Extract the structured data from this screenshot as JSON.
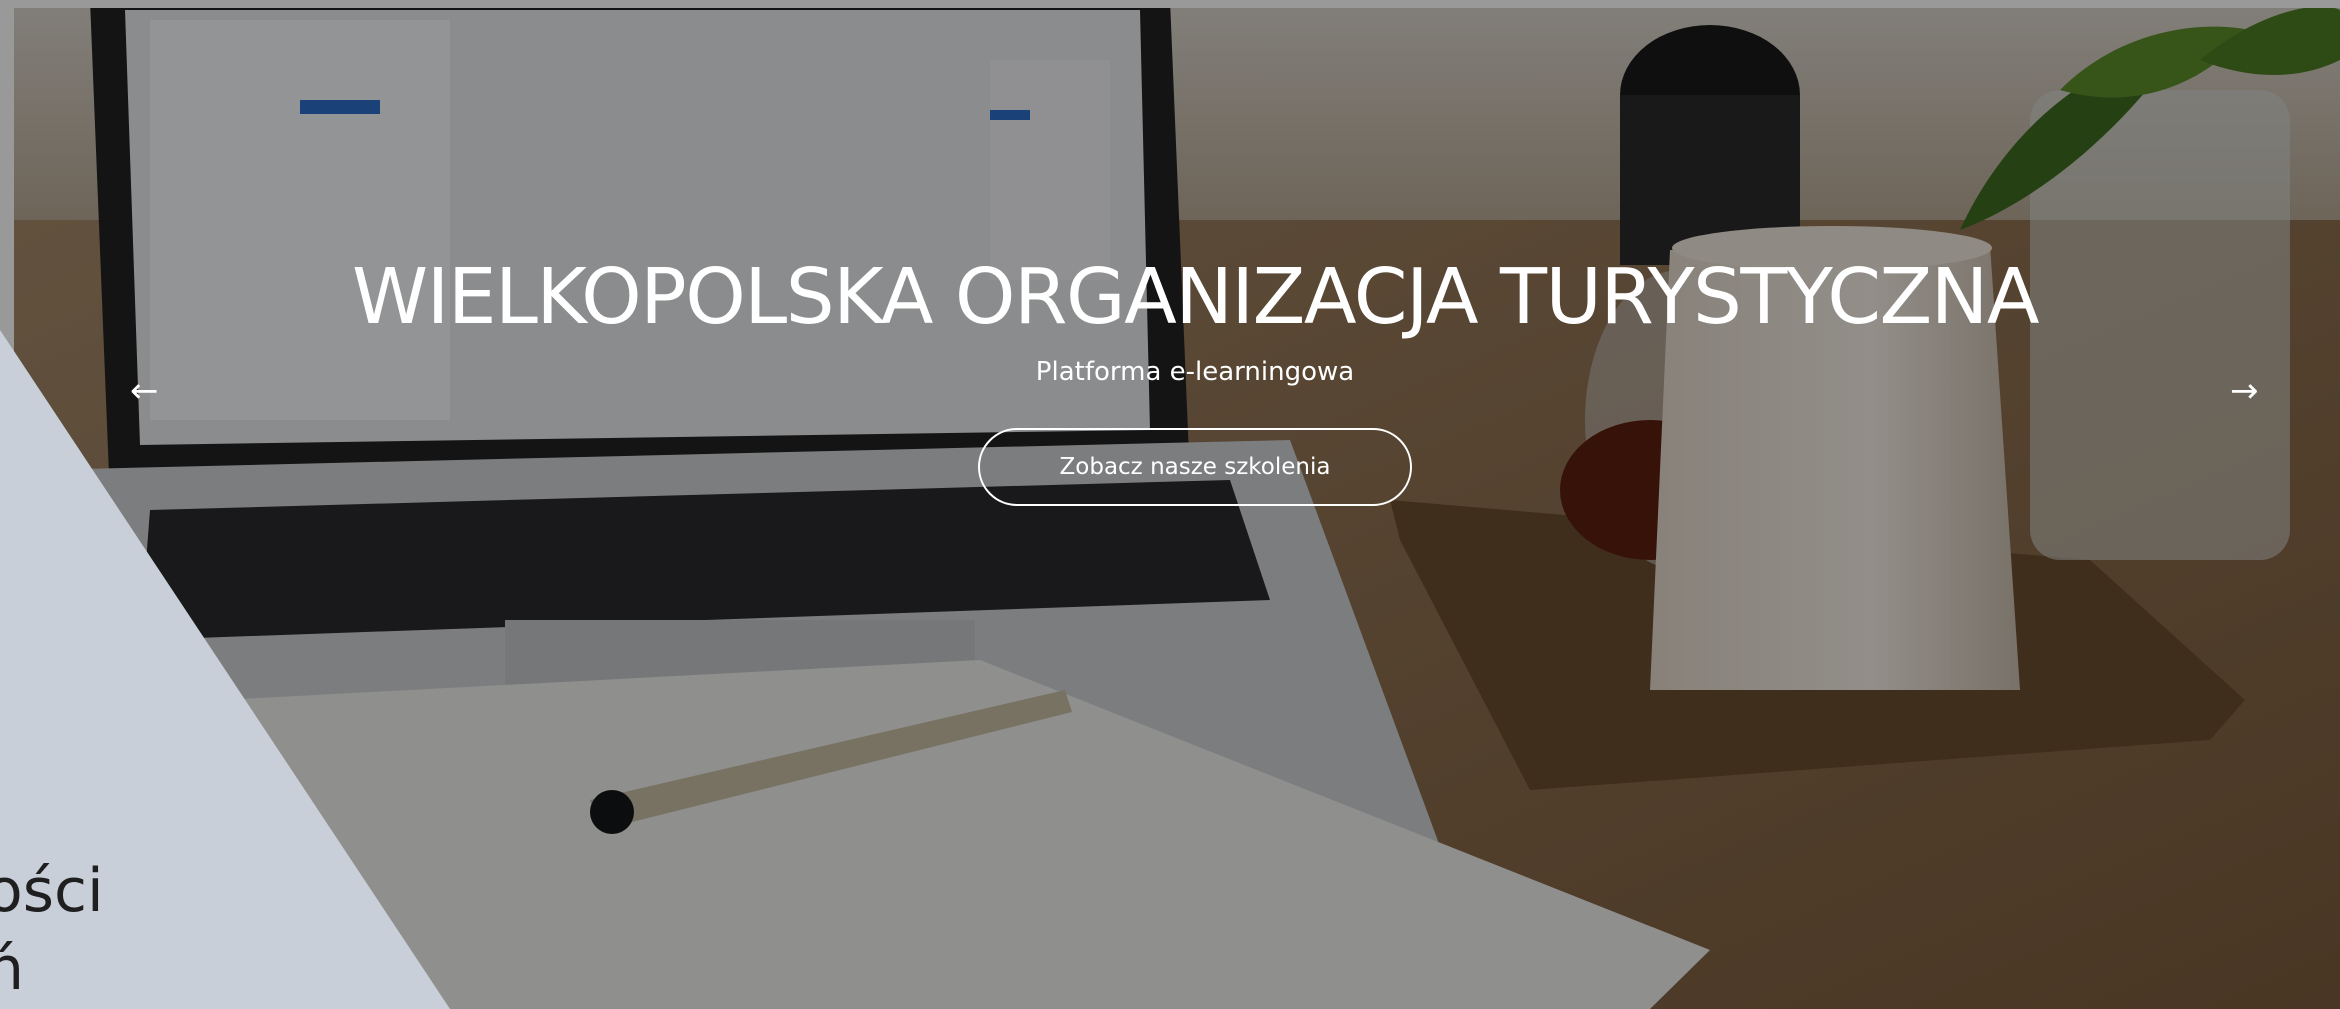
{
  "hero": {
    "title": "WIELKOPOLSKA ORGANIZACJA TURYSTYCZNA",
    "subtitle": "Platforma e-learningowa",
    "cta_label": "Zobacz nasze szkolenia",
    "prev_arrow": "←",
    "next_arrow": "→"
  },
  "side_panel": {
    "lines": [
      "ości",
      "ń"
    ],
    "background_color": "#c8cfd8"
  }
}
